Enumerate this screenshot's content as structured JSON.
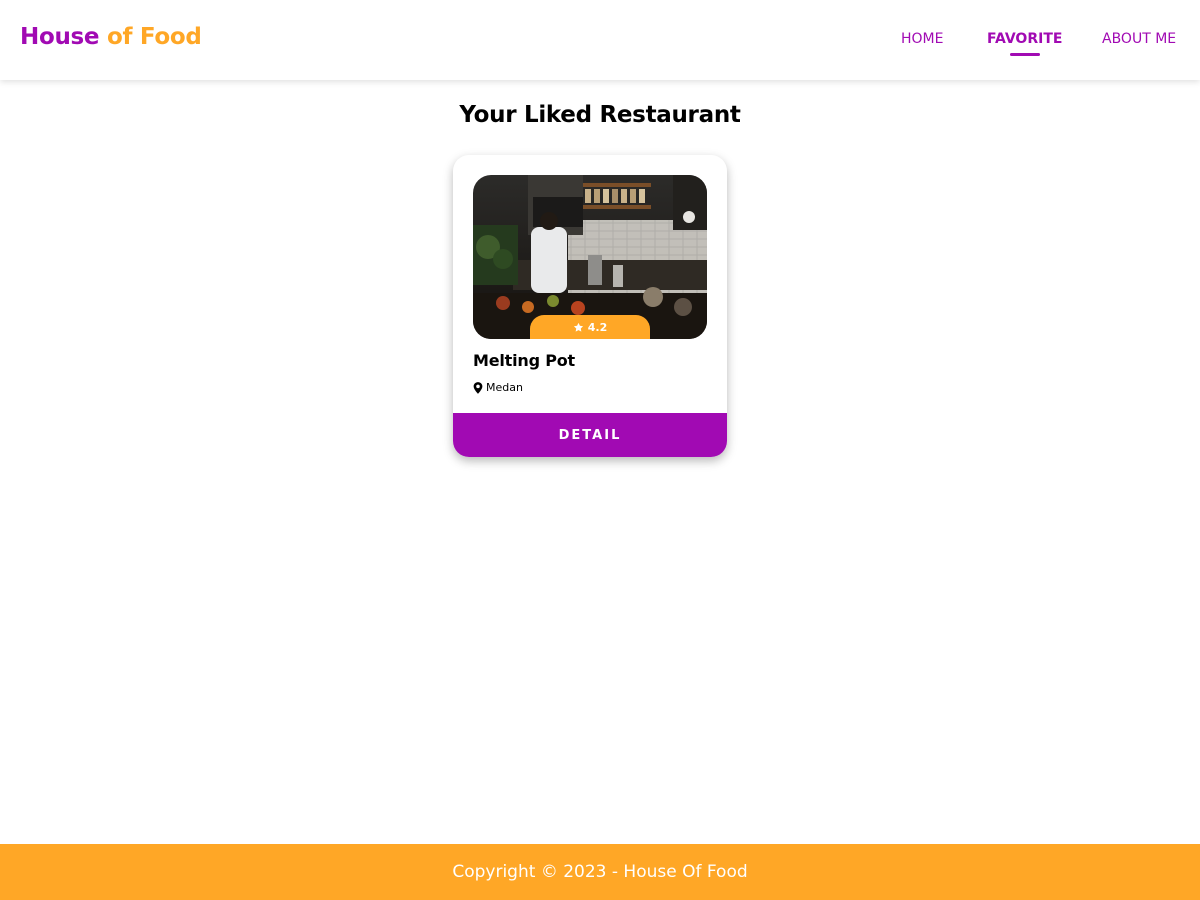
{
  "header": {
    "logo_part1": "House",
    "logo_part2": "of Food",
    "nav": [
      {
        "label": "HOME"
      },
      {
        "label": "FAVORITE",
        "active": true
      },
      {
        "label": "ABOUT ME"
      }
    ]
  },
  "main": {
    "title": "Your Liked Restaurant",
    "restaurants": [
      {
        "name": "Melting Pot",
        "city": "Medan",
        "rating": "4.2",
        "detail_label": "DETAIL"
      }
    ]
  },
  "footer": {
    "text": "Copyright © 2023 - House Of Food"
  },
  "colors": {
    "primary": "#a10ab3",
    "accent": "#ffa726",
    "background": "#ffffff"
  },
  "icons": {
    "rating": "star-icon",
    "location": "map-pin-icon"
  }
}
